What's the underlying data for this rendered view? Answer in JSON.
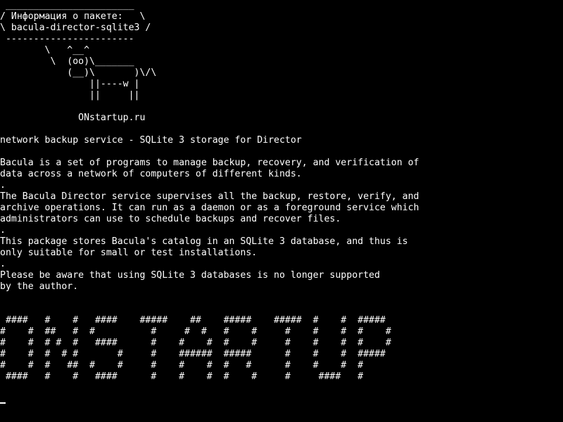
{
  "terminal": {
    "cowsay": [
      " _______________________",
      "/ Информация о пакете:   \\",
      "\\ bacula-director-sqlite3 /",
      " -----------------------",
      "        \\   ^__^",
      "         \\  (oo)\\_______",
      "            (__)\\       )\\/\\",
      "                ||----w |",
      "                ||     ||",
      "",
      "              ONstartup.ru"
    ],
    "description": [
      "network backup service - SQLite 3 storage for Director",
      "",
      "Bacula is a set of programs to manage backup, recovery, and verification of",
      "data across a network of computers of different kinds.",
      ".",
      "The Bacula Director service supervises all the backup, restore, verify, and",
      "archive operations. It can run as a daemon or as a foreground service which",
      "administrators can use to schedule backups and recover files.",
      ".",
      "This package stores Bacula's catalog in an SQLite 3 database, and thus is",
      "only suitable for small or test installations.",
      ".",
      "Please be aware that using SQLite 3 databases is no longer supported",
      "by the author."
    ],
    "banner": [
      " ####   #    #   ####    #####    ##    #####    #####  #    #  #####",
      "#    #  ##   #  #          #     #  #   #    #     #    #    #  #    #",
      "#    #  # #  #   ####      #    #    #  #    #     #    #    #  #    #",
      "#    #  #  # #       #     #    ######  #####      #    #    #  #####",
      "#    #  #   ##  #    #     #    #    #  #   #      #    #    #  #",
      " ####   #    #   ####      #    #    #  #    #     #     ####   #"
    ]
  }
}
